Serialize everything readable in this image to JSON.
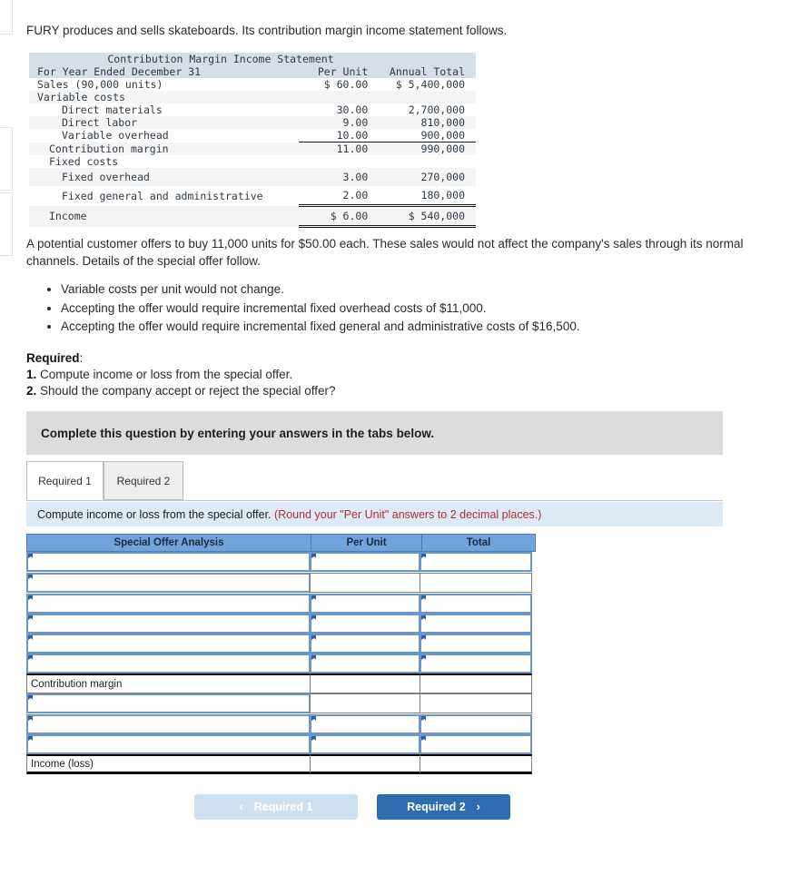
{
  "intro": {
    "text": "FURY produces and sells skateboards. Its contribution margin income statement follows."
  },
  "income_statement": {
    "title": "Contribution Margin Income Statement",
    "period_label": "For Year Ended December 31",
    "col_per_unit": "Per Unit",
    "col_annual_total": "Annual Total",
    "rows": [
      {
        "label": "Sales (90,000 units)",
        "per_unit": "$ 60.00",
        "total": "$ 5,400,000"
      },
      {
        "label": "Variable costs",
        "per_unit": "",
        "total": ""
      },
      {
        "label": "Direct materials",
        "per_unit": "30.00",
        "total": "2,700,000"
      },
      {
        "label": "Direct labor",
        "per_unit": "9.00",
        "total": "810,000"
      },
      {
        "label": "Variable overhead",
        "per_unit": "10.00",
        "total": "900,000"
      },
      {
        "label": "Contribution margin",
        "per_unit": "11.00",
        "total": "990,000"
      },
      {
        "label": "Fixed costs",
        "per_unit": "",
        "total": ""
      },
      {
        "label": "Fixed overhead",
        "per_unit": "3.00",
        "total": "270,000"
      },
      {
        "label": "Fixed general and administrative",
        "per_unit": "2.00",
        "total": "180,000"
      },
      {
        "label": "Income",
        "per_unit": "$ 6.00",
        "total": "$ 540,000"
      }
    ]
  },
  "offer": {
    "paragraph": "A potential customer offers to buy 11,000 units for $50.00 each. These sales would not affect the company's sales through its normal channels. Details of the special offer follow.",
    "bullets": [
      "Variable costs per unit would not change.",
      "Accepting the offer would require incremental fixed overhead costs of $11,000.",
      "Accepting the offer would require incremental fixed general and administrative costs of $16,500."
    ]
  },
  "required": {
    "heading": "Required",
    "heading_colon": ":",
    "item1_num": "1.",
    "item1_text": "Compute income or loss from the special offer.",
    "item2_num": "2.",
    "item2_text": "Should the company accept or reject the special offer?"
  },
  "banner": {
    "text": "Complete this question by entering your answers in the tabs below."
  },
  "tabs": [
    {
      "label": "Required 1",
      "active": true
    },
    {
      "label": "Required 2",
      "active": false
    }
  ],
  "prompt": {
    "text": "Compute income or loss from the special offer.",
    "hint": "(Round your \"Per Unit\" answers to 2 decimal places.)"
  },
  "answer_grid": {
    "headers": {
      "label": "Special Offer Analysis",
      "per_unit": "Per Unit",
      "total": "Total"
    },
    "rows": [
      {
        "label": "",
        "per_unit": "",
        "total": "",
        "type": "input"
      },
      {
        "label": "",
        "per_unit": "",
        "total": "",
        "type": "input"
      },
      {
        "label": "",
        "per_unit": "",
        "total": "",
        "type": "input"
      },
      {
        "label": "",
        "per_unit": "",
        "total": "",
        "type": "input"
      },
      {
        "label": "",
        "per_unit": "",
        "total": "",
        "type": "input"
      },
      {
        "label": "",
        "per_unit": "",
        "total": "",
        "type": "input"
      },
      {
        "label": "Contribution margin",
        "per_unit": "",
        "total": "",
        "type": "static"
      },
      {
        "label": "",
        "per_unit": "",
        "total": "",
        "type": "input"
      },
      {
        "label": "",
        "per_unit": "",
        "total": "",
        "type": "input"
      },
      {
        "label": "",
        "per_unit": "",
        "total": "",
        "type": "input"
      },
      {
        "label": "Income (loss)",
        "per_unit": "",
        "total": "",
        "type": "static-total"
      }
    ]
  },
  "nav": {
    "prev_label": "Required 1",
    "prev_icon": "chevron-left",
    "prev_chevron": "‹",
    "next_label": "Required 2",
    "next_icon": "chevron-right",
    "next_chevron": "›"
  },
  "colors": {
    "grid_header_blue": "#72a2da",
    "input_border_blue": "#6b98c8",
    "prompt_blue": "#deeaf6",
    "banner_gray": "#dcdcdc",
    "hint_red": "#b03030",
    "next_button_blue": "#2f6cb0",
    "prev_button_blue": "#cfe0f1",
    "statement_header_gray": "#d8dee8"
  }
}
